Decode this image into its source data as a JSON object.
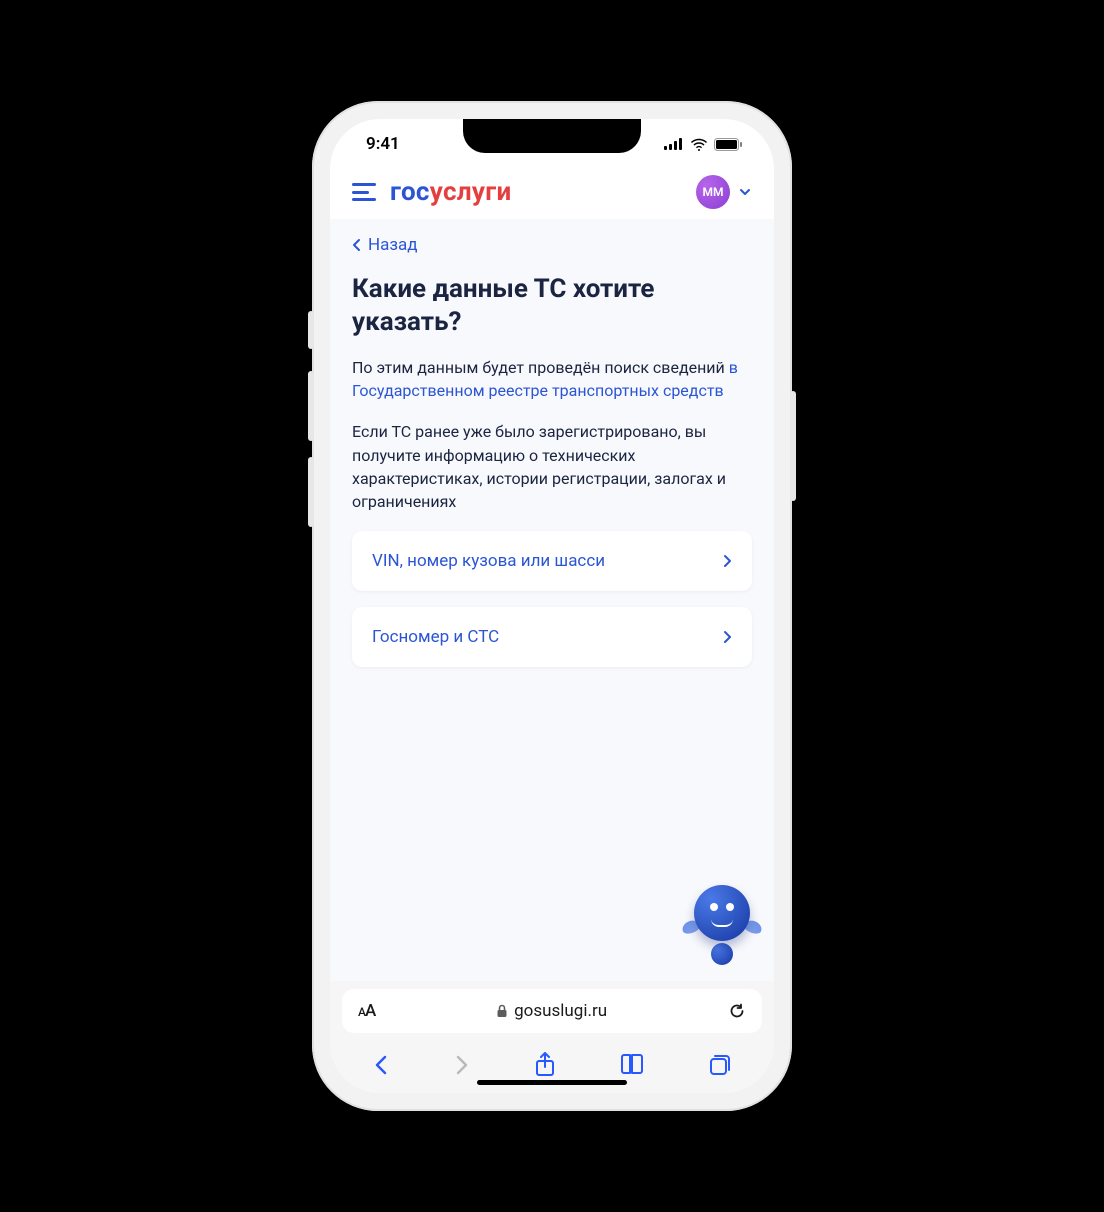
{
  "status": {
    "time": "9:41"
  },
  "header": {
    "logo_part1": "гос",
    "logo_part2": "услуги",
    "avatar_initials": "ММ"
  },
  "page": {
    "back_label": "Назад",
    "title": "Какие данные ТС хотите указать?",
    "desc1_pre": "По этим данным будет проведён поиск сведений ",
    "desc1_link": "в Государственном реестре транспортных средств",
    "desc2": "Если ТС ранее уже было зарегистрировано, вы получите информацию о технических характеристиках, истории регистрации, залогах и ограничениях"
  },
  "options": [
    {
      "label": "VIN, номер кузова или шасси"
    },
    {
      "label": "Госномер и СТС"
    }
  ],
  "browser": {
    "aa": "AA",
    "domain": "gosuslugi.ru"
  }
}
